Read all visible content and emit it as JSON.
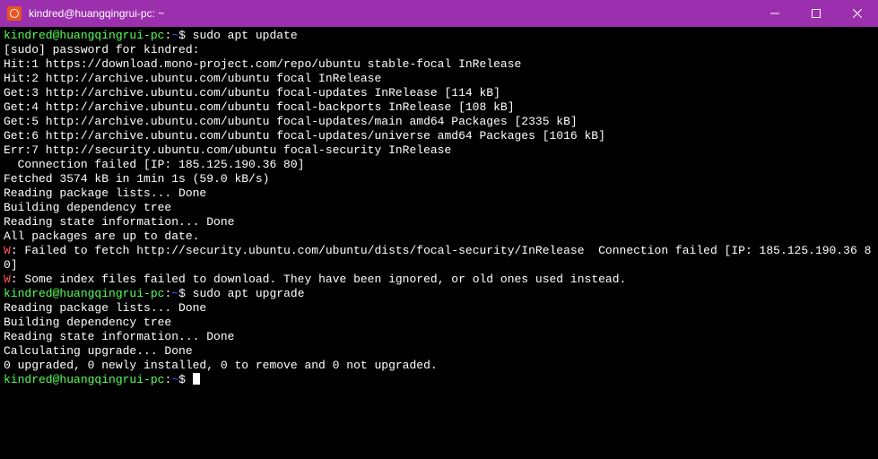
{
  "window": {
    "title": "kindred@huangqingrui-pc: ~"
  },
  "prompt": {
    "user_host": "kindred@huangqingrui-pc",
    "sep1": ":",
    "path": "~",
    "sep2": "$ "
  },
  "session": {
    "cmd1": "sudo apt update",
    "lines1": [
      "[sudo] password for kindred:",
      "Hit:1 https://download.mono-project.com/repo/ubuntu stable-focal InRelease",
      "Hit:2 http://archive.ubuntu.com/ubuntu focal InRelease",
      "Get:3 http://archive.ubuntu.com/ubuntu focal-updates InRelease [114 kB]",
      "Get:4 http://archive.ubuntu.com/ubuntu focal-backports InRelease [108 kB]",
      "Get:5 http://archive.ubuntu.com/ubuntu focal-updates/main amd64 Packages [2335 kB]",
      "Get:6 http://archive.ubuntu.com/ubuntu focal-updates/universe amd64 Packages [1016 kB]",
      "Err:7 http://security.ubuntu.com/ubuntu focal-security InRelease",
      "  Connection failed [IP: 185.125.190.36 80]",
      "Fetched 3574 kB in 1min 1s (59.0 kB/s)",
      "Reading package lists... Done",
      "Building dependency tree",
      "Reading state information... Done",
      "All packages are up to date."
    ],
    "warn1_prefix": "W",
    "warn1_rest": ": Failed to fetch http://security.ubuntu.com/ubuntu/dists/focal-security/InRelease  Connection failed [IP: 185.125.190.36 80]",
    "warn2_prefix": "W",
    "warn2_rest": ": Some index files failed to download. They have been ignored, or old ones used instead.",
    "cmd2": "sudo apt upgrade",
    "lines2": [
      "Reading package lists... Done",
      "Building dependency tree",
      "Reading state information... Done",
      "Calculating upgrade... Done",
      "0 upgraded, 0 newly installed, 0 to remove and 0 not upgraded."
    ]
  }
}
